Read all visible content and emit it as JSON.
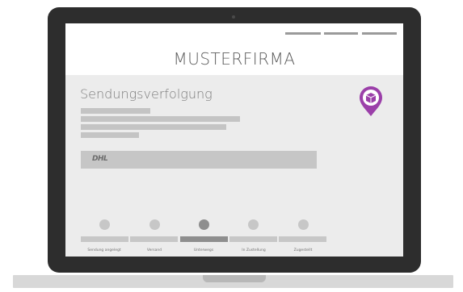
{
  "site": {
    "brand": "MUSTERFIRMA"
  },
  "tracking": {
    "title": "Sendungsverfolgung",
    "carrier_logo": "DHL",
    "steps": [
      {
        "label": "Sendung angelegt",
        "active": false
      },
      {
        "label": "Versand",
        "active": false
      },
      {
        "label": "Unterwegs",
        "active": true
      },
      {
        "label": "In Zustellung",
        "active": false
      },
      {
        "label": "Zugestellt",
        "active": false
      }
    ]
  },
  "icons": {
    "tracking_pin": "package-location-pin-icon"
  },
  "colors": {
    "pin_accent": "#9b3fa9",
    "active_step": "#8e8e8e",
    "inactive_step": "#c7c7c7"
  }
}
